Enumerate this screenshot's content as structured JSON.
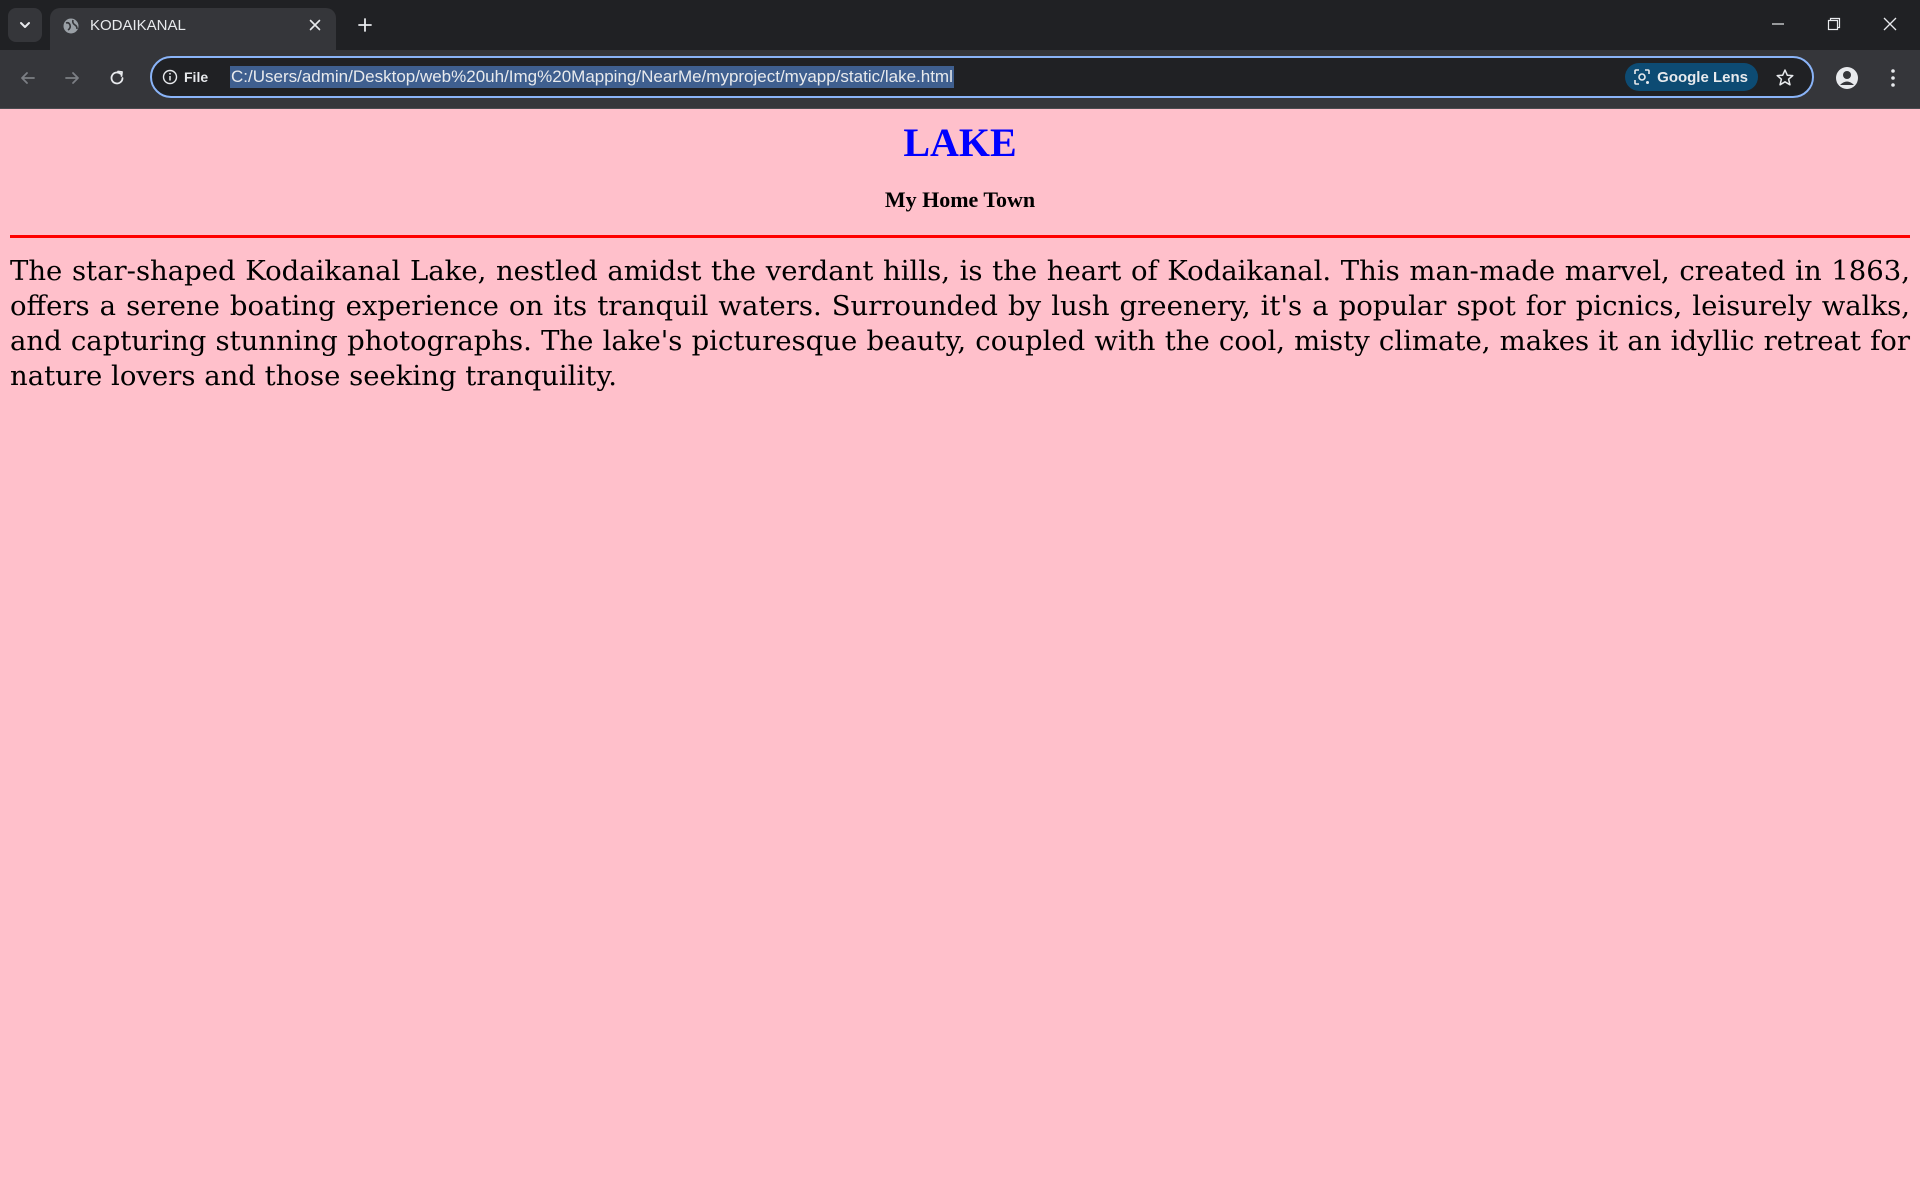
{
  "browser": {
    "tab": {
      "title": "KODAIKANAL"
    },
    "omnibox": {
      "site_info_label": "File",
      "url": "C:/Users/admin/Desktop/web%20uh/Img%20Mapping/NearMe/myproject/myapp/static/lake.html",
      "lens_label": "Google Lens"
    }
  },
  "page": {
    "title": "LAKE",
    "subtitle": "My Home Town",
    "body": "The star-shaped Kodaikanal Lake, nestled amidst the verdant hills, is the heart of Kodaikanal. This man-made marvel, created in 1863, offers a serene boating experience on its tranquil waters. Surrounded by lush greenery, it's a popular spot for picnics, leisurely walks, and capturing stunning photographs. The lake's picturesque beauty, coupled with the cool, misty climate, makes it an idyllic retreat for nature lovers and those seeking tranquility."
  },
  "colors": {
    "page_background": "#ffc0cb",
    "title": "#0000ff",
    "divider": "#ff0000",
    "omnibox_focus": "#8ab4f8"
  },
  "icons": {
    "tab_search": "chevron-down-icon",
    "favicon": "globe-icon",
    "tab_close": "close-icon",
    "new_tab": "plus-icon",
    "minimize": "minimize-icon",
    "restore": "restore-icon",
    "close_window": "close-icon",
    "back": "arrow-left-icon",
    "forward": "arrow-right-icon",
    "reload": "reload-icon",
    "site_info": "info-icon",
    "lens": "lens-icon",
    "bookmark": "star-icon",
    "profile": "person-icon",
    "menu": "kebab-menu-icon"
  }
}
